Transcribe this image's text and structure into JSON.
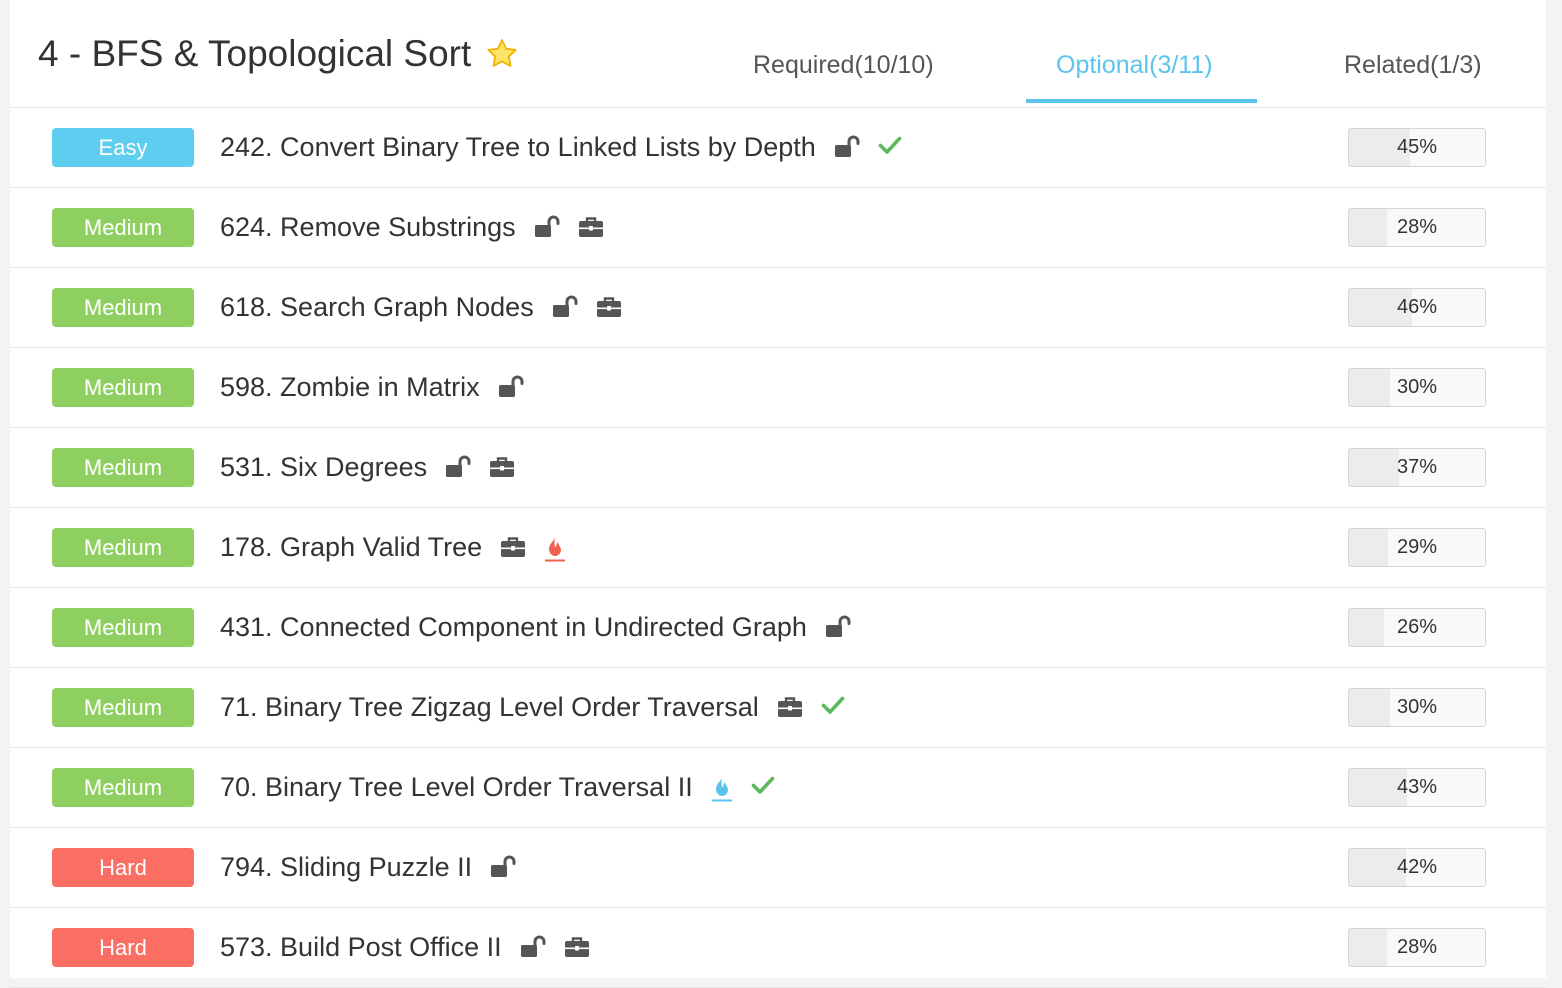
{
  "header": {
    "title": "4 - BFS & Topological Sort",
    "tabs": [
      {
        "label": "Required(10/10)",
        "active": false
      },
      {
        "label": "Optional(3/11)",
        "active": true
      },
      {
        "label": "Related(1/3)",
        "active": false
      }
    ]
  },
  "colors": {
    "accent": "#5bc4ec",
    "easy": "#5fcdf0",
    "medium": "#8fcf61",
    "hard": "#fa6e63",
    "check": "#5cb85c",
    "flame_red": "#f0604f",
    "flame_blue": "#5bc4ec",
    "icon_dark": "#555555"
  },
  "problems": [
    {
      "difficulty": "Easy",
      "level": "easy",
      "name": "242. Convert Binary Tree to Linked Lists by Depth",
      "icons": [
        "unlock-icon",
        "check-icon"
      ],
      "rate": "45%",
      "rate_value": 45
    },
    {
      "difficulty": "Medium",
      "level": "medium",
      "name": "624. Remove Substrings",
      "icons": [
        "unlock-icon",
        "briefcase-icon"
      ],
      "rate": "28%",
      "rate_value": 28
    },
    {
      "difficulty": "Medium",
      "level": "medium",
      "name": "618. Search Graph Nodes",
      "icons": [
        "unlock-icon",
        "briefcase-icon"
      ],
      "rate": "46%",
      "rate_value": 46
    },
    {
      "difficulty": "Medium",
      "level": "medium",
      "name": "598. Zombie in Matrix",
      "icons": [
        "unlock-icon"
      ],
      "rate": "30%",
      "rate_value": 30
    },
    {
      "difficulty": "Medium",
      "level": "medium",
      "name": "531. Six Degrees",
      "icons": [
        "unlock-icon",
        "briefcase-icon"
      ],
      "rate": "37%",
      "rate_value": 37
    },
    {
      "difficulty": "Medium",
      "level": "medium",
      "name": "178. Graph Valid Tree",
      "icons": [
        "briefcase-icon",
        "flame-red-icon"
      ],
      "rate": "29%",
      "rate_value": 29
    },
    {
      "difficulty": "Medium",
      "level": "medium",
      "name": "431. Connected Component in Undirected Graph",
      "icons": [
        "unlock-icon"
      ],
      "rate": "26%",
      "rate_value": 26
    },
    {
      "difficulty": "Medium",
      "level": "medium",
      "name": "71. Binary Tree Zigzag Level Order Traversal",
      "icons": [
        "briefcase-icon",
        "check-icon"
      ],
      "rate": "30%",
      "rate_value": 30
    },
    {
      "difficulty": "Medium",
      "level": "medium",
      "name": "70. Binary Tree Level Order Traversal II",
      "icons": [
        "flame-blue-icon",
        "check-icon"
      ],
      "rate": "43%",
      "rate_value": 43
    },
    {
      "difficulty": "Hard",
      "level": "hard",
      "name": "794. Sliding Puzzle II",
      "icons": [
        "unlock-icon"
      ],
      "rate": "42%",
      "rate_value": 42
    },
    {
      "difficulty": "Hard",
      "level": "hard",
      "name": "573. Build Post Office II",
      "icons": [
        "unlock-icon",
        "briefcase-icon"
      ],
      "rate": "28%",
      "rate_value": 28
    }
  ]
}
